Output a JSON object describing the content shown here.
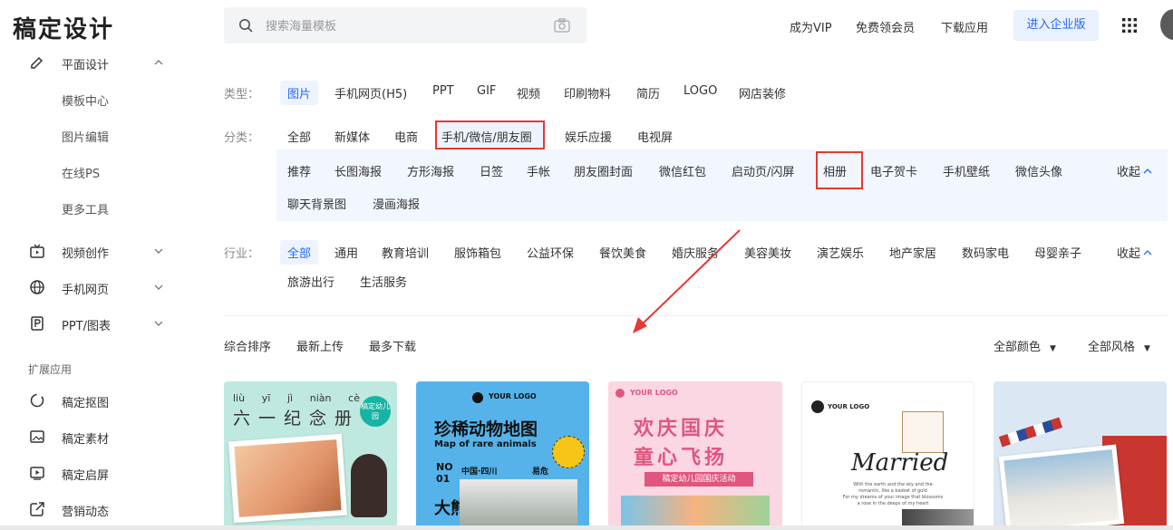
{
  "header": {
    "logo": "稿定设计",
    "search_placeholder": "搜索海量模板",
    "links": [
      "成为VIP",
      "免费领会员",
      "下载应用"
    ],
    "enterprise_button": "进入企业版"
  },
  "sidebar": {
    "groups": [
      {
        "label": "平面设计",
        "icon": "pen-icon",
        "expanded": true,
        "children": [
          "模板中心",
          "图片编辑",
          "在线PS",
          "更多工具"
        ]
      },
      {
        "label": "视频创作",
        "icon": "tv-icon"
      },
      {
        "label": "手机网页",
        "icon": "globe-icon"
      },
      {
        "label": "PPT/图表",
        "icon": "ppt-icon"
      }
    ],
    "section_title": "扩展应用",
    "ext_items": [
      {
        "label": "稿定抠图",
        "icon": "cutout-icon"
      },
      {
        "label": "稿定素材",
        "icon": "image-icon"
      },
      {
        "label": "稿定启屏",
        "icon": "play-icon"
      },
      {
        "label": "营销动态",
        "icon": "share-icon"
      }
    ]
  },
  "filters": {
    "type": {
      "label": "类型：",
      "options": [
        "图片",
        "手机网页(H5)",
        "PPT",
        "GIF",
        "视频",
        "印刷物料",
        "简历",
        "LOGO",
        "网店装修"
      ],
      "selected": "图片"
    },
    "category": {
      "label": "分类：",
      "options": [
        "全部",
        "新媒体",
        "电商",
        "手机/微信/朋友圈",
        "娱乐应援",
        "电视屏"
      ],
      "selected": "手机/微信/朋友圈"
    },
    "subcategory": {
      "options": [
        "推荐",
        "长图海报",
        "方形海报",
        "日签",
        "手帐",
        "朋友圈封面",
        "微信红包",
        "启动页/闪屏",
        "相册",
        "电子贺卡",
        "手机壁纸",
        "微信头像",
        "聊天背景图",
        "漫画海报"
      ],
      "selected": "相册",
      "collapse_label": "收起"
    },
    "industry": {
      "label": "行业：",
      "options": [
        "全部",
        "通用",
        "教育培训",
        "服饰箱包",
        "公益环保",
        "餐饮美食",
        "婚庆服务",
        "美容美妆",
        "演艺娱乐",
        "地产家居",
        "数码家电",
        "母婴亲子",
        "旅游出行",
        "生活服务"
      ],
      "selected": "全部",
      "collapse_label": "收起"
    }
  },
  "sort": {
    "options": [
      "综合排序",
      "最新上传",
      "最多下载"
    ],
    "selected": "综合排序",
    "color_filter": "全部颜色",
    "style_filter": "全部风格"
  },
  "templates": [
    {
      "title": "六一纪念册",
      "pinyin": [
        "liù",
        "yī",
        "jì",
        "niàn",
        "cè"
      ],
      "badge": "稿定幼儿园",
      "bg": "#bfe9e0"
    },
    {
      "logo": "YOUR LOGO",
      "title": "珍稀动物地图",
      "subtitle": "Map of rare animals",
      "number": "NO 01",
      "place": "中国·四川",
      "tag": "易危",
      "side": "大熊",
      "bg": "#55b3ea"
    },
    {
      "logo": "YOUR LOGO",
      "title1": "欢庆国庆",
      "title2": "童心飞扬",
      "ribbon": "稿定幼儿园国庆活动",
      "bg": "#fad7e2"
    },
    {
      "logo": "YOUR LOGO",
      "title": "Married",
      "note1": "With the earth and the sky and the",
      "note2": "romantic, like a basket of gold",
      "note3": "For my dreams of your image that blossoms",
      "note4": "a rose in the deeps of my heart",
      "bg": "#ffffff"
    },
    {
      "bg": "#dbe8f3"
    }
  ],
  "colors": {
    "accent": "#2468f2",
    "highlight": "#e53935",
    "panel": "#f2f6ff"
  }
}
